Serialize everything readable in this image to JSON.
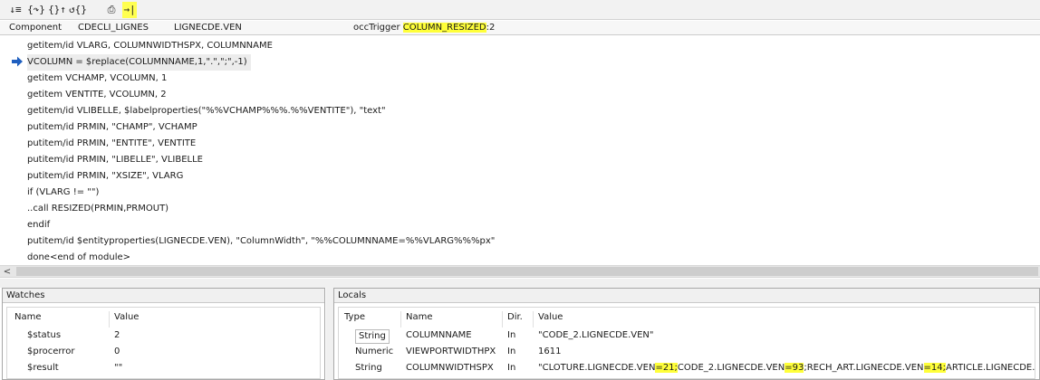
{
  "toolbar": {
    "buttons": [
      {
        "name": "step-into-icon",
        "glyph": "↓≡"
      },
      {
        "name": "step-over-icon",
        "glyph": "{↷}"
      },
      {
        "name": "step-out-icon",
        "glyph": "{}↑"
      },
      {
        "name": "continue-icon",
        "glyph": "↺{}"
      },
      {
        "name": "print-icon",
        "glyph": "⎙"
      },
      {
        "name": "run-to-cursor-icon",
        "glyph": "→|"
      }
    ]
  },
  "info_bar": {
    "component_label": "Component",
    "component": "CDECLI_LIGNES",
    "entity": "LIGNECDE.VEN",
    "trigger_label": "occTrigger",
    "trigger_name": "COLUMN_RESIZED",
    "trigger_suffix": ":2"
  },
  "code": {
    "current_line_index": 1,
    "lines": [
      "getitem/id VLARG, COLUMNWIDTHSPX, COLUMNNAME",
      "VCOLUMN = $replace(COLUMNNAME,1,\".\",\";\",-1)",
      "getitem VCHAMP, VCOLUMN, 1",
      "getitem VENTITE, VCOLUMN, 2",
      "getitem/id VLIBELLE, $labelproperties(\"%%VCHAMP%%%.%%VENTITE\"), \"text\"",
      "putitem/id PRMIN, \"CHAMP\", VCHAMP",
      "putitem/id PRMIN, \"ENTITE\", VENTITE",
      "putitem/id PRMIN, \"LIBELLE\", VLIBELLE",
      "putitem/id PRMIN, \"XSIZE\", VLARG",
      "if (VLARG != \"\")",
      "..call RESIZED(PRMIN,PRMOUT)",
      "endif",
      "putitem/id $entityproperties(LIGNECDE.VEN), \"ColumnWidth\", \"%%COLUMNNAME=%%VLARG%%%px\"",
      "done<end of module>"
    ]
  },
  "watches": {
    "title": "Watches",
    "headers": {
      "name": "Name",
      "value": "Value"
    },
    "rows": [
      {
        "name": "$status",
        "value": "2"
      },
      {
        "name": "$procerror",
        "value": "0"
      },
      {
        "name": "$result",
        "value": "\"\""
      }
    ]
  },
  "locals": {
    "title": "Locals",
    "headers": {
      "type": "Type",
      "name": "Name",
      "dir": "Dir.",
      "value": "Value"
    },
    "rows": [
      {
        "type": "String",
        "name": "COLUMNNAME",
        "dir": "In",
        "value": "\"CODE_2.LIGNECDE.VEN\""
      },
      {
        "type": "Numeric",
        "name": "VIEWPORTWIDTHPX",
        "dir": "In",
        "value": "1611"
      },
      {
        "type": "String",
        "name": "COLUMNWIDTHSPX",
        "dir": "In",
        "value_parts": [
          {
            "t": "\"CLOTURE.LIGNECDE.VEN",
            "hl": false
          },
          {
            "t": "=21;",
            "hl": true
          },
          {
            "t": "CODE_2.LIGNECDE.VEN",
            "hl": false
          },
          {
            "t": "=93",
            "hl": true
          },
          {
            "t": ";RECH_ART.LIGNECDE.VEN",
            "hl": false
          },
          {
            "t": "=14;",
            "hl": true
          },
          {
            "t": "ARTICLE.LIGNECDE.V...",
            "hl": false
          }
        ]
      }
    ]
  },
  "colors": {
    "highlight": "#ffff3a",
    "arrow": "#1f5fbf"
  }
}
